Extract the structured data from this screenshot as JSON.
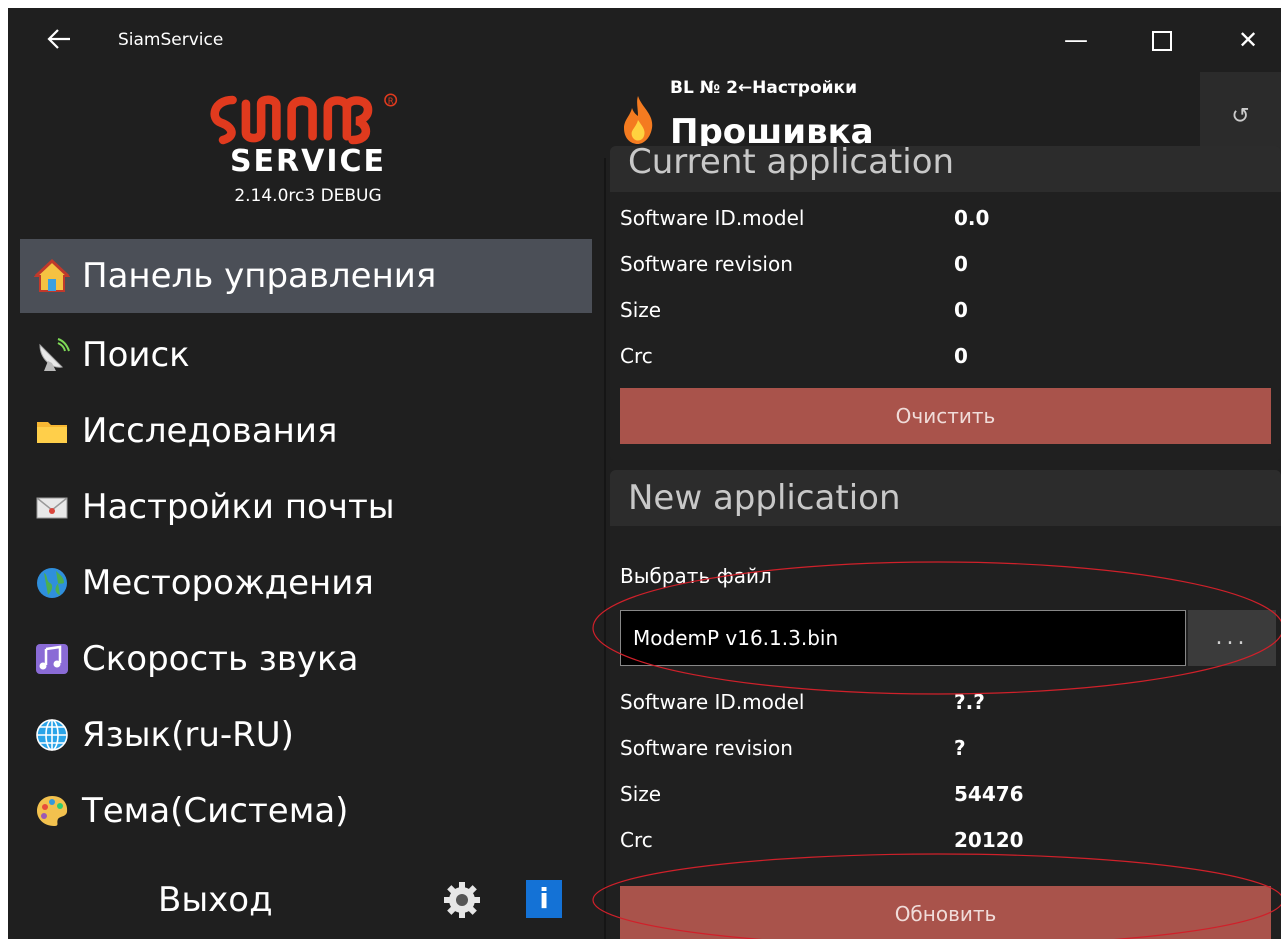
{
  "window": {
    "title": "SiamService",
    "back_icon": "arrow-left-icon",
    "minimize_glyph": "—",
    "close_glyph": "✕"
  },
  "sidebar": {
    "logo_service": "SERVICE",
    "version": "2.14.0rc3 DEBUG",
    "items": [
      {
        "label": "Панель управления",
        "icon": "house-icon",
        "active": true
      },
      {
        "label": "Поиск",
        "icon": "satellite-dish-icon"
      },
      {
        "label": "Исследования",
        "icon": "folder-icon"
      },
      {
        "label": "Настройки почты",
        "icon": "envelope-icon"
      },
      {
        "label": "Месторождения",
        "icon": "globe-icon"
      },
      {
        "label": "Скорость звука",
        "icon": "music-notes-icon"
      },
      {
        "label": "Язык(ru-RU)",
        "icon": "web-globe-icon"
      },
      {
        "label": "Тема(Система)",
        "icon": "palette-icon"
      }
    ],
    "exit_label": "Выход",
    "info_glyph": "i"
  },
  "main": {
    "breadcrumb": "BL № 2←Настройки",
    "title": "Прошивка",
    "refresh_glyph": "↺",
    "current": {
      "header": "Current application",
      "rows": [
        {
          "label": "Software ID.model",
          "value": "0.0"
        },
        {
          "label": "Software revision",
          "value": "0"
        },
        {
          "label": "Size",
          "value": "0"
        },
        {
          "label": "Crc",
          "value": "0"
        }
      ],
      "clear_label": "Очистить"
    },
    "new": {
      "header": "New application",
      "choose_file_label": "Выбрать файл",
      "file_value": "ModemP v16.1.3.bin",
      "browse_label": "...",
      "rows": [
        {
          "label": "Software ID.model",
          "value": "?.?"
        },
        {
          "label": "Software revision",
          "value": "?"
        },
        {
          "label": "Size",
          "value": "54476"
        },
        {
          "label": "Crc",
          "value": "20120"
        }
      ],
      "update_label": "Обновить"
    }
  },
  "colors": {
    "background": "#1f1f1f",
    "active_nav": "#4b4f57",
    "action_button": "#a9534b",
    "info_button": "#1472d6",
    "annotation": "#d0202a"
  }
}
